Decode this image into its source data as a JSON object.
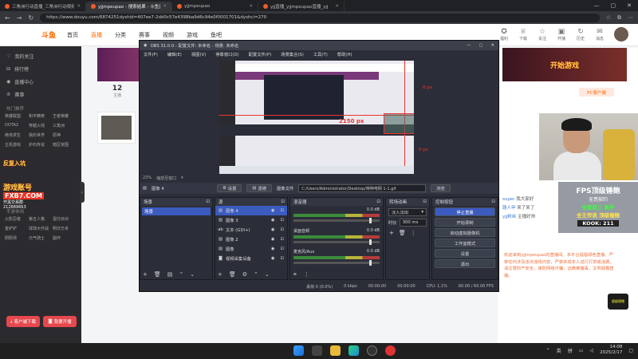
{
  "browser": {
    "tabs": [
      {
        "title": "三角洲行动直播_三角洲行动视频",
        "active": false
      },
      {
        "title": "yjjmpeupao - 搜索结果 - 斗鱼直播",
        "active": true
      },
      {
        "title": "yjjmpeupao",
        "active": false
      },
      {
        "title": "yjj直播_yjjmpeupao直播_yjj",
        "active": false
      }
    ],
    "url": "https://www.douyu.com/6874251dyshid=407ee7-2dd0c57e4398ba9d6c94e0f0001701&dyshci=270"
  },
  "site": {
    "logo": "斗鱼",
    "nav": [
      {
        "label": "首页",
        "active": false
      },
      {
        "label": "直播",
        "active": true
      },
      {
        "label": "分类",
        "active": false
      },
      {
        "label": "赛事",
        "active": false
      },
      {
        "label": "视频",
        "active": false
      },
      {
        "label": "游戏",
        "active": false
      },
      {
        "label": "鱼吧",
        "active": false
      }
    ],
    "header_icons": [
      {
        "icon": "gift-icon",
        "glyph": "✪",
        "label": "福利"
      },
      {
        "icon": "crown-icon",
        "glyph": "♕",
        "label": "下载"
      },
      {
        "icon": "star-icon",
        "glyph": "☆",
        "label": "关注"
      },
      {
        "icon": "box-icon",
        "glyph": "▣",
        "label": "开播"
      },
      {
        "icon": "history-icon",
        "glyph": "↻",
        "label": "历史"
      },
      {
        "icon": "chat-icon",
        "glyph": "✉",
        "label": "消息"
      }
    ],
    "sidebar": {
      "items": [
        {
          "icon": "heart-icon",
          "glyph": "♡",
          "label": "我的关注"
        },
        {
          "icon": "rank-icon",
          "glyph": "⊟",
          "label": "排行榜"
        },
        {
          "icon": "live-icon",
          "glyph": "◉",
          "label": "直播中心"
        },
        {
          "icon": "trophy-icon",
          "glyph": "♔",
          "label": "赛事"
        }
      ],
      "section1_title": "热门推荐",
      "grid1": [
        "英雄联盟",
        "和平精英",
        "王者荣耀",
        "DOTA2",
        "穿越火线",
        "三角洲",
        "绝地求生",
        "我的世界",
        "原神",
        "主机游戏",
        "炉石传说",
        "暗区突围"
      ],
      "section2_title": "手游休闲",
      "grid2": [
        "火影忍者",
        "第五人格",
        "蛋仔派对",
        "金铲铲",
        "球球大作战",
        "明日方舟",
        "阴阳师",
        "元气骑士",
        "崩坏"
      ],
      "promo": {
        "r1": "反复入坑",
        "r2": "游戏账号",
        "r3": "FXB7.COM",
        "r4": "开黑交易群·",
        "r5": "212889663"
      },
      "btn_client": "客户端下载",
      "btn_shot": "我要开播"
    },
    "stats": {
      "count": "12",
      "label": "主播"
    },
    "game_banner": "开始游戏",
    "pc_button": "PC客户端",
    "chat": [
      {
        "user": "super",
        "text": "我大家好"
      },
      {
        "user": "路人甲",
        "text": "来了来了"
      },
      {
        "user": "yjj粉丝",
        "text": "主播好帅"
      }
    ],
    "notice": "欢迎来到yjjmpeupao的直播间。本平台提倡绿色直播，严禁任何涉及违法违规内容，严禁未成年人进行打赏或消费，请注意财产安全，谨防网络诈骗，远离黄赌毒，文明观看直播。"
  },
  "overlay": {
    "title": "FPS顶级锤鲍",
    "line2": "无畏契约",
    "line3": "全服前三 高手",
    "line4": "全王传说 顶级锤鲍",
    "line5": "KOOK: 211",
    "badge": "超级锤鲍"
  },
  "obs": {
    "title": "OBS 31.0.0 - 配置文件: 未命名 - 场景: 未命名",
    "menu": [
      "文件(F)",
      "编辑(E)",
      "视图(V)",
      "停靠窗口(D)",
      "配置文件(P)",
      "场景集合(S)",
      "工具(T)",
      "帮助(H)"
    ],
    "preview_px_center": "2150 px",
    "preview_px_top": "8 px",
    "preview_px_bottom": "0 px",
    "zoom": "23%",
    "zoom_label": "缩放至窗口",
    "source_name": "图像 4",
    "btn_props": "设置",
    "btn_filters": "滤镜",
    "image_file_label": "图像文件",
    "path": "C:/Users/Administrator/Desktop/特种电网 1-1.gif",
    "browse": "浏览",
    "scenes_title": "场景",
    "scenes": [
      "场景"
    ],
    "sources_title": "源",
    "sources": [
      {
        "name": "图像 4",
        "icon": "image-icon",
        "glyph": "▨",
        "selected": true
      },
      {
        "name": "图像 3",
        "icon": "image-icon",
        "glyph": "▨",
        "selected": false
      },
      {
        "name": "文本 (GDI+)",
        "icon": "text-icon",
        "glyph": "ab",
        "selected": false
      },
      {
        "name": "图像 2",
        "icon": "image-icon",
        "glyph": "▨",
        "selected": false
      },
      {
        "name": "图像",
        "icon": "image-icon",
        "glyph": "▨",
        "selected": false
      },
      {
        "name": "视频采集设备",
        "icon": "camera-icon",
        "glyph": "◙",
        "selected": false
      }
    ],
    "mixer_title": "混音器",
    "mixer": [
      {
        "name": "",
        "db": "0.0 dB"
      },
      {
        "name": "桌面音频",
        "db": "0.0 dB"
      },
      {
        "name": "麦克风/Aux",
        "db": "0.0 dB"
      }
    ],
    "transitions_title": "转场动画",
    "transition": "淡入淡出",
    "duration_label": "时长",
    "duration": "300 ms",
    "controls_title": "控制按钮",
    "controls": [
      {
        "label": "停止直播",
        "stream": true
      },
      {
        "label": "开始录制",
        "stream": false
      },
      {
        "label": "启动虚拟摄像机",
        "stream": false
      },
      {
        "label": "工作室模式",
        "stream": false
      },
      {
        "label": "设置",
        "stream": false
      },
      {
        "label": "退出",
        "stream": false
      }
    ],
    "status": {
      "dropped": "丢帧 0 (0.0%)",
      "kbps": "0 kbps",
      "time1": "00:00:00",
      "time2": "00:00:00",
      "cpu": "CPU: 1.1%",
      "fps": "60.00 / 60.00 FPS"
    }
  },
  "taskbar": {
    "tray_lang": "英",
    "tray_ime": "拼",
    "time": "14:08",
    "date": "2025/2/17"
  },
  "colors": {
    "douyu_orange": "#ff6a00",
    "obs_bg": "#2b2e38",
    "obs_accent": "#3b5bbf"
  }
}
